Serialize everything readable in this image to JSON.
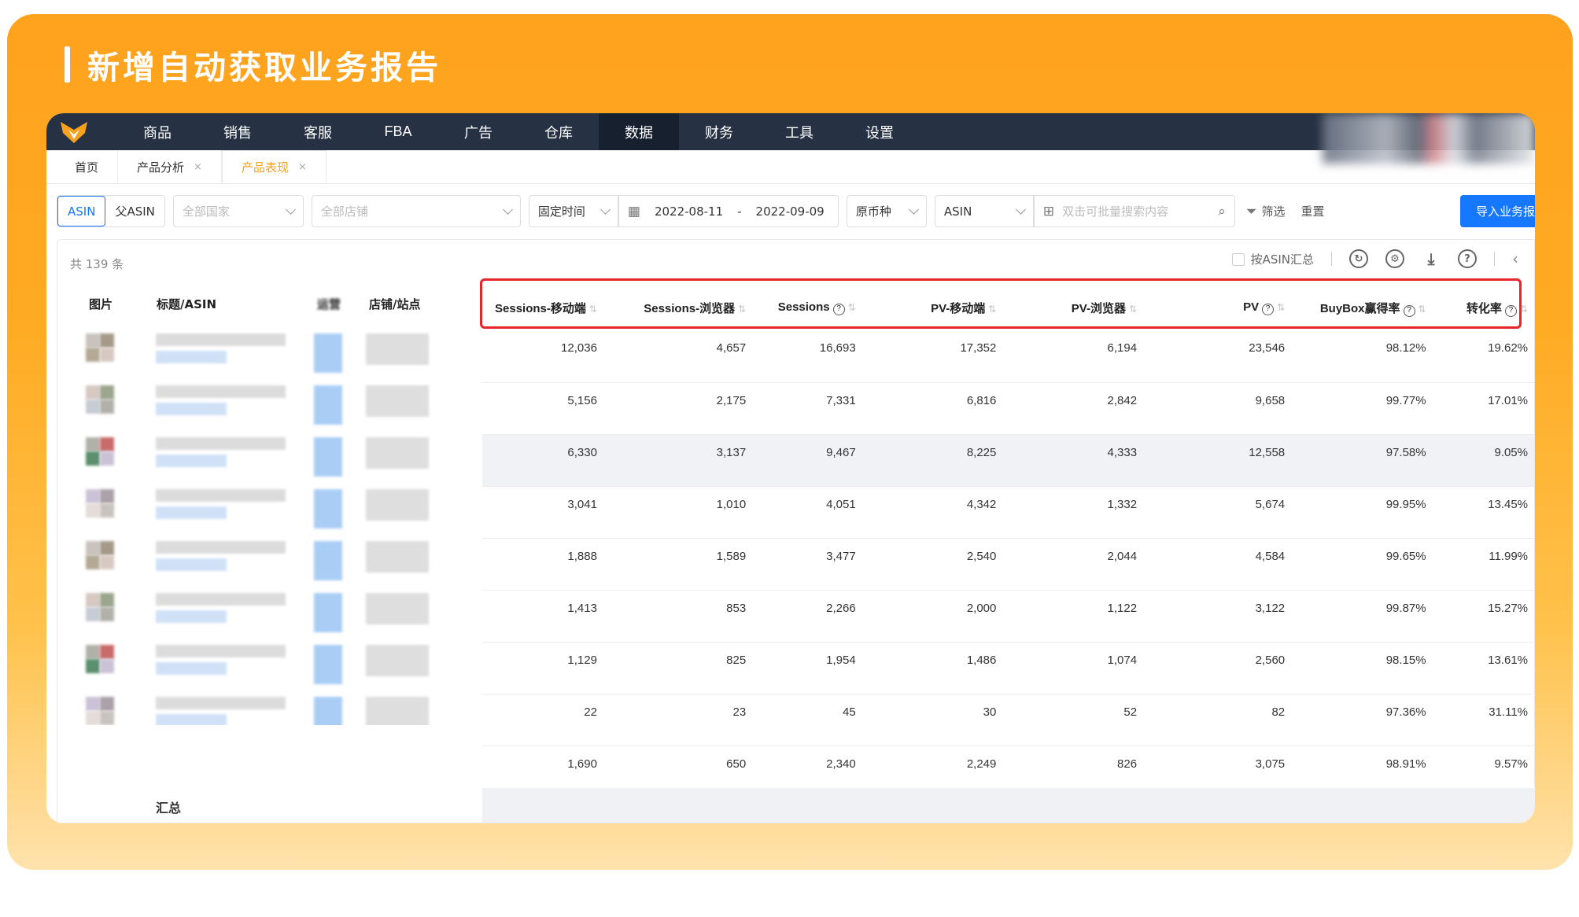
{
  "heading": "新增自动获取业务报告",
  "nav": {
    "items": [
      "商品",
      "销售",
      "客服",
      "FBA",
      "广告",
      "仓库",
      "数据",
      "财务",
      "工具",
      "设置"
    ],
    "active": "数据"
  },
  "tabs": [
    {
      "label": "首页",
      "closable": false
    },
    {
      "label": "产品分析",
      "closable": true
    },
    {
      "label": "产品表现",
      "closable": true,
      "active": true
    }
  ],
  "filters": {
    "asin_toggle": [
      "ASIN",
      "父ASIN"
    ],
    "country_placeholder": "全部国家",
    "shop_placeholder": "全部店铺",
    "time_mode": "固定时间",
    "date_start": "2022-08-11",
    "date_sep": "-",
    "date_end": "2022-09-09",
    "currency": "原币种",
    "search_field": "ASIN",
    "search_placeholder": "双击可批量搜索内容",
    "filter_label": "筛选",
    "reset_label": "重置",
    "import_label": "导入业务报"
  },
  "table": {
    "total": "共 139 条",
    "group_by_asin": "按ASIN汇总",
    "left_headers": [
      "图片",
      "标题/ASIN",
      "运营",
      "店铺/站点"
    ],
    "headers": [
      {
        "label": "Sessions-移动端",
        "help": false
      },
      {
        "label": "Sessions-浏览器",
        "help": false
      },
      {
        "label": "Sessions",
        "help": true
      },
      {
        "label": "PV-移动端",
        "help": false
      },
      {
        "label": "PV-浏览器",
        "help": false
      },
      {
        "label": "PV",
        "help": true
      },
      {
        "label": "BuyBox赢得率",
        "help": true
      },
      {
        "label": "转化率",
        "help": true
      }
    ],
    "rows": [
      [
        "12,036",
        "4,657",
        "16,693",
        "17,352",
        "6,194",
        "23,546",
        "98.12%",
        "19.62%"
      ],
      [
        "5,156",
        "2,175",
        "7,331",
        "6,816",
        "2,842",
        "9,658",
        "99.77%",
        "17.01%"
      ],
      [
        "6,330",
        "3,137",
        "9,467",
        "8,225",
        "4,333",
        "12,558",
        "97.58%",
        "9.05%"
      ],
      [
        "3,041",
        "1,010",
        "4,051",
        "4,342",
        "1,332",
        "5,674",
        "99.95%",
        "13.45%"
      ],
      [
        "1,888",
        "1,589",
        "3,477",
        "2,540",
        "2,044",
        "4,584",
        "99.65%",
        "11.99%"
      ],
      [
        "1,413",
        "853",
        "2,266",
        "2,000",
        "1,122",
        "3,122",
        "99.87%",
        "15.27%"
      ],
      [
        "1,129",
        "825",
        "1,954",
        "1,486",
        "1,074",
        "2,560",
        "98.15%",
        "13.61%"
      ],
      [
        "22",
        "23",
        "45",
        "30",
        "52",
        "82",
        "97.36%",
        "31.11%"
      ],
      [
        "1,690",
        "650",
        "2,340",
        "2,249",
        "826",
        "3,075",
        "98.91%",
        "9.57%"
      ]
    ],
    "highlight_row": 2,
    "summary_label": "汇总"
  },
  "colors": {
    "accent": "#f6a21e",
    "nav_bg": "#263244",
    "primary": "#1677ff",
    "highlight": "#e8242b"
  }
}
